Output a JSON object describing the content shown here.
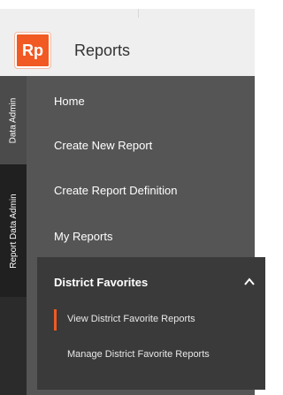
{
  "header": {
    "logo_text": "Rp",
    "title": "Reports"
  },
  "rail": {
    "tabs": [
      {
        "label": "Data Admin"
      },
      {
        "label": "Report Data Admin"
      }
    ]
  },
  "menu": {
    "items": [
      {
        "label": "Home"
      },
      {
        "label": "Create New Report"
      },
      {
        "label": "Create Report Definition"
      },
      {
        "label": "My Reports"
      }
    ],
    "favorites": {
      "title": "District Favorites",
      "items": [
        {
          "label": "View District Favorite Reports",
          "active": true
        },
        {
          "label": "Manage District Favorite Reports",
          "active": false
        }
      ]
    }
  },
  "colors": {
    "accent": "#f15a22",
    "menu_bg": "#555555",
    "submenu_bg": "#3a3a3a",
    "rail_bg": "#2b2b2b"
  }
}
